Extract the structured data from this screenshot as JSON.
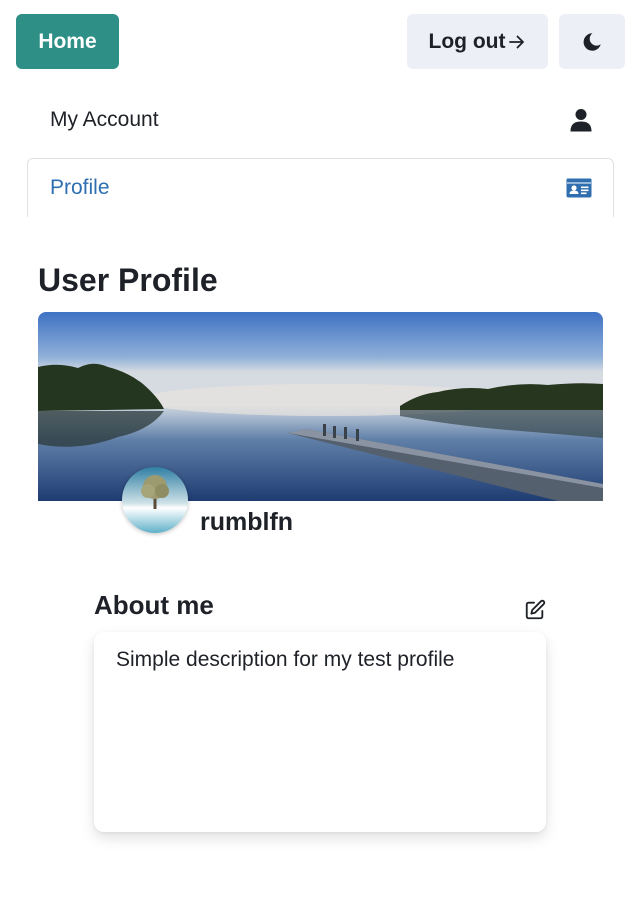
{
  "header": {
    "home_label": "Home",
    "logout_label": "Log out",
    "logout_icon": "arrow-right-icon",
    "theme_icon": "moon-icon"
  },
  "nav": {
    "items": [
      {
        "label": "My Account",
        "icon": "user-icon",
        "active": false
      },
      {
        "label": "Profile",
        "icon": "id-card-icon",
        "active": true
      }
    ]
  },
  "profile": {
    "title": "User Profile",
    "username": "rumblfn",
    "about_title": "About me",
    "about_text": "Simple description for my test profile",
    "edit_icon": "edit-icon"
  },
  "colors": {
    "accent": "#2e8f86",
    "secondary_button": "#eceff5",
    "link_active": "#2f6fb0",
    "text": "#1e2127"
  }
}
